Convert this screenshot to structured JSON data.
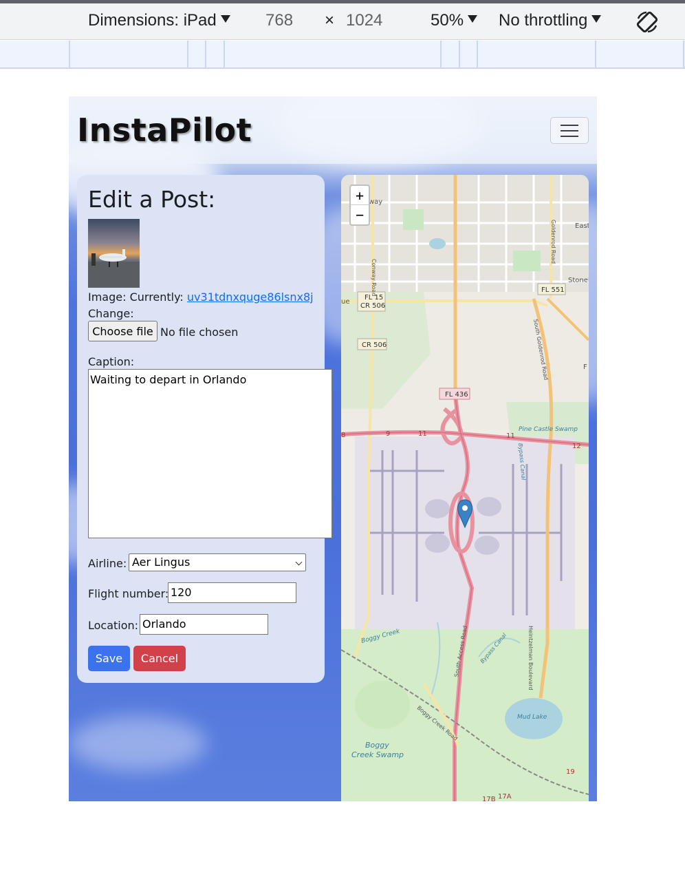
{
  "devtools": {
    "dimensions_label": "Dimensions: iPad",
    "width": "768",
    "times": "×",
    "height": "1024",
    "zoom": "50%",
    "throttling": "No throttling",
    "rotate_icon": "rotate-device-icon"
  },
  "navbar": {
    "brand": "InstaPilot",
    "menu_icon": "hamburger-menu-icon"
  },
  "form": {
    "heading": "Edit a Post:",
    "image_label": "Image: Currently: ",
    "image_link": "uv31tdnxquge86lsnx8j",
    "change_label": "Change:",
    "file_button": "Choose file",
    "file_status": "No file chosen",
    "caption_label": "Caption:",
    "caption_value": "Waiting to depart in Orlando",
    "airline_label": "Airline:",
    "airline_value": "Aer Lingus",
    "flight_label": "Flight number:",
    "flight_value": "120",
    "location_label": "Location:",
    "location_value": "Orlando",
    "save": "Save",
    "cancel": "Cancel"
  },
  "map": {
    "zoom_in": "+",
    "zoom_out": "−",
    "labels": {
      "way": "way",
      "east": "East",
      "stone": "StoneE",
      "fl551": "FL 551",
      "fl15": "FL 15",
      "cr506a": "CR 506",
      "cr506b": "CR 506",
      "fl436": "FL 436",
      "conway": "Conway Road",
      "goldenrod": "Goldenrod Road",
      "south_goldenrod": "South Goldenrod Road",
      "pine_castle": "Pine Castle Swamp",
      "bypass_canal": "Bypass Canal",
      "boggy_creek": "Boggy Creek",
      "south_access": "South Access Road",
      "heintzelman": "Heintzelman Boulevard",
      "boggy_creek_road": "Boggy Creek Road",
      "mud_lake": "Mud Lake",
      "boggy_swamp_1": "Boggy",
      "boggy_swamp_2": "Creek Swamp",
      "n9": "9",
      "n11a": "11",
      "n11b": "11",
      "n12": "12",
      "n8": "8",
      "n19": "19",
      "n17b": "17B",
      "n17a": "17A",
      "ue": "ue",
      "f": "F"
    },
    "marker_icon": "map-marker-icon"
  }
}
